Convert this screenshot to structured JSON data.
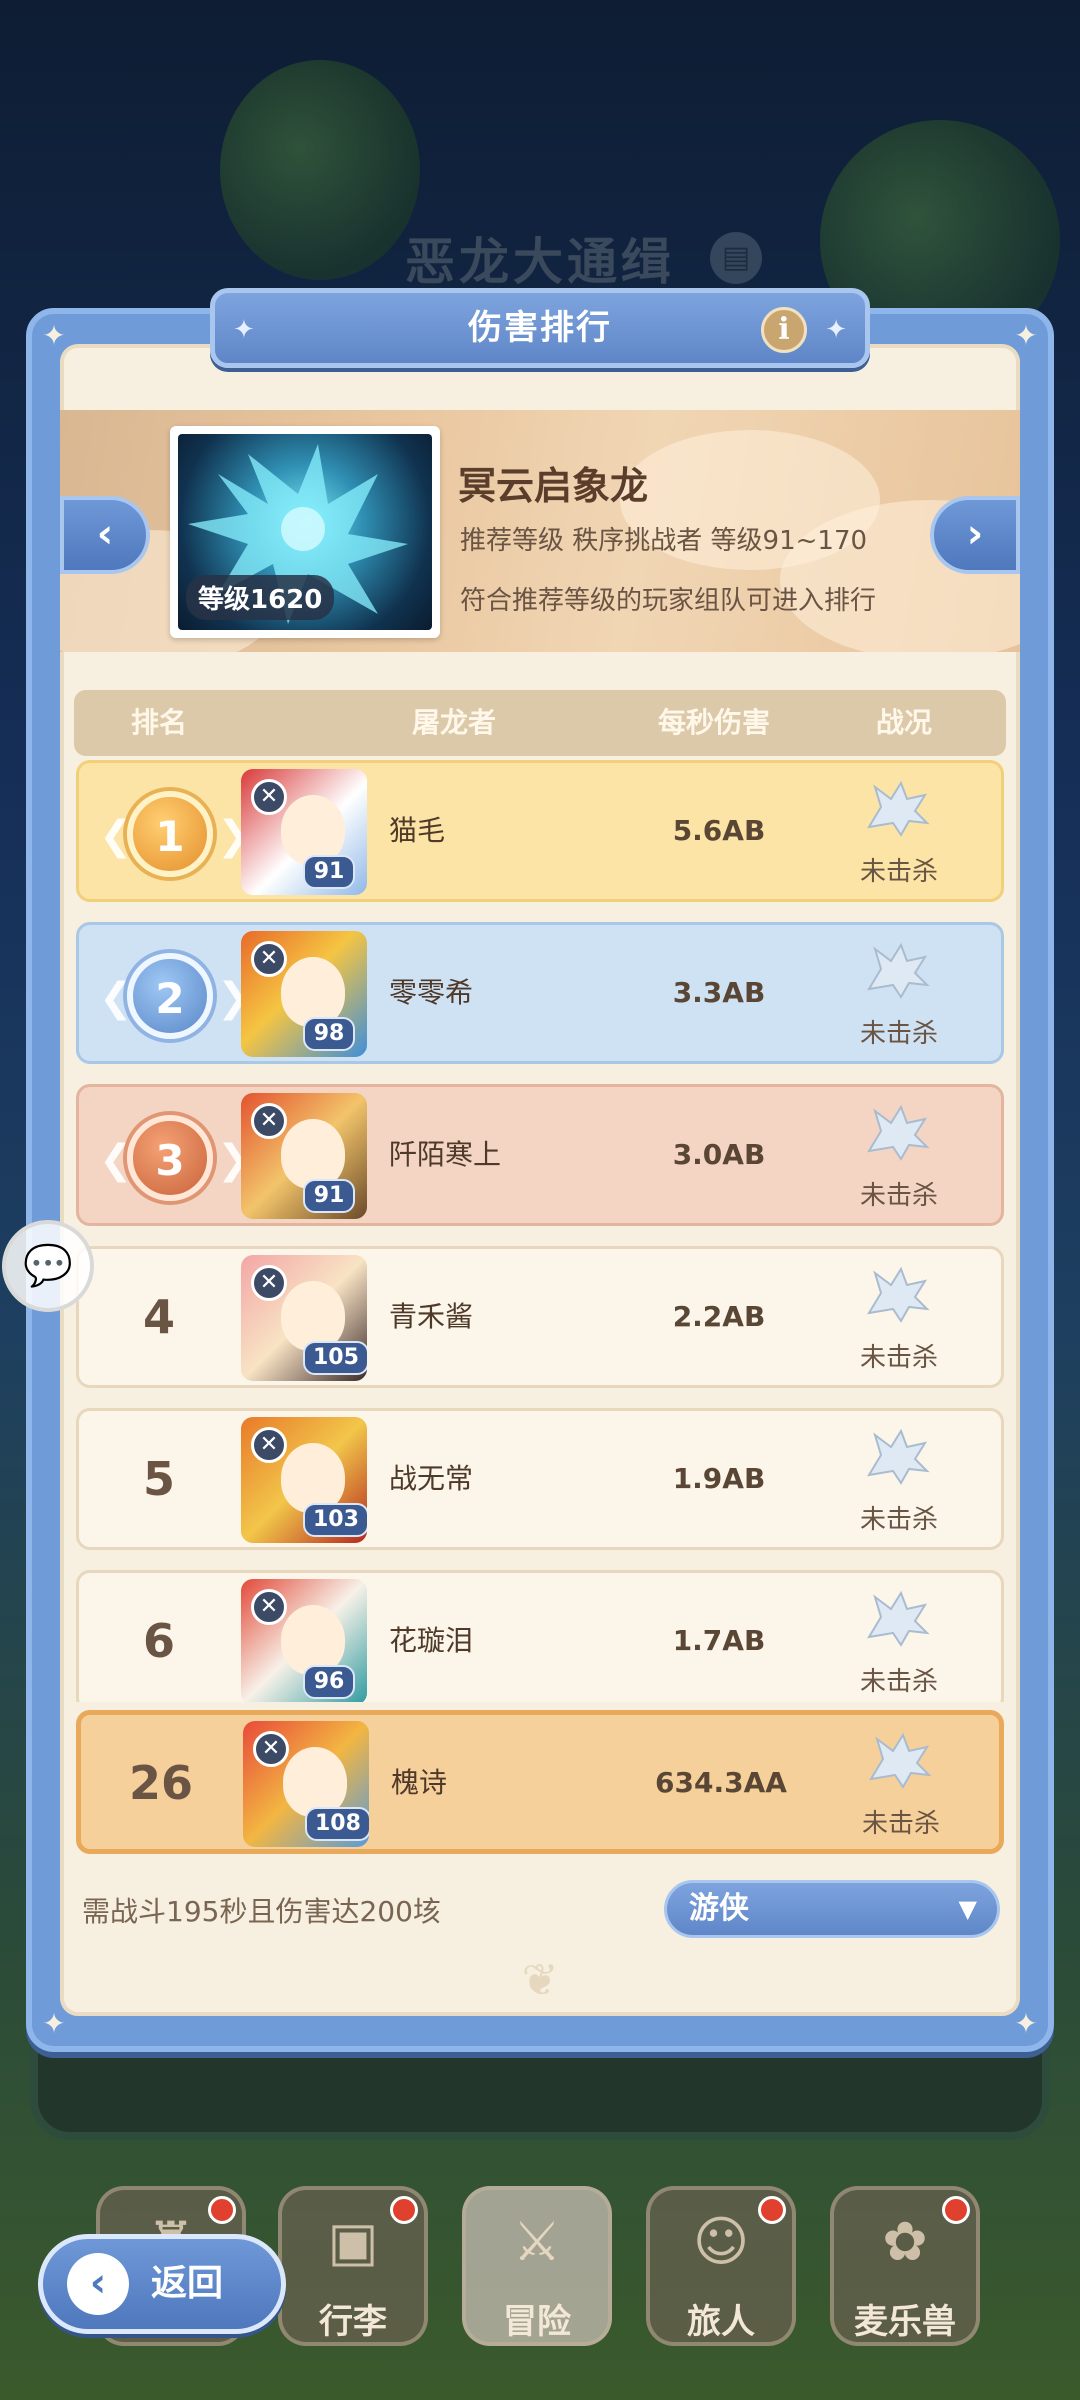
{
  "background": {
    "event_title": "恶龙大通缉",
    "event_icon_name": "scroll-badge-icon"
  },
  "dialog": {
    "title": "伤害排行",
    "info_icon": "info-icon"
  },
  "boss": {
    "name": "冥云启象龙",
    "level_label": "等级1620",
    "recommend_text": "推荐等级 秩序挑战者 等级91~170",
    "note_text": "符合推荐等级的玩家组队可进入排行",
    "prev_icon": "chevron-left-icon",
    "next_icon": "chevron-right-icon"
  },
  "table": {
    "headers": [
      "排名",
      "屠龙者",
      "每秒伤害",
      "战况"
    ],
    "rows": [
      {
        "rank": "1",
        "medal": "gold",
        "level": "91",
        "name": "猫毛",
        "dps": "5.6AB",
        "status": "未击杀"
      },
      {
        "rank": "2",
        "medal": "silver",
        "level": "98",
        "name": "零零希",
        "dps": "3.3AB",
        "status": "未击杀"
      },
      {
        "rank": "3",
        "medal": "bronze",
        "level": "91",
        "name": "阡陌寒上",
        "dps": "3.0AB",
        "status": "未击杀"
      },
      {
        "rank": "4",
        "medal": "",
        "level": "105",
        "name": "青禾酱",
        "dps": "2.2AB",
        "status": "未击杀"
      },
      {
        "rank": "5",
        "medal": "",
        "level": "103",
        "name": "战无常",
        "dps": "1.9AB",
        "status": "未击杀"
      },
      {
        "rank": "6",
        "medal": "",
        "level": "96",
        "name": "花璇泪",
        "dps": "1.7AB",
        "status": "未击杀"
      }
    ],
    "me": {
      "rank": "26",
      "level": "108",
      "name": "槐诗",
      "dps": "634.3AA",
      "status": "未击杀"
    }
  },
  "footer": {
    "requirement": "需战斗195秒且伤害达200垓",
    "class_select_value": "游侠"
  },
  "bottom_nav": {
    "back_label": "返回",
    "items": [
      {
        "label": "",
        "icon": "castle-icon",
        "dot": true
      },
      {
        "label": "行李",
        "icon": "chest-icon",
        "dot": true
      },
      {
        "label": "冒险",
        "icon": "crossed-swords-icon",
        "dot": false
      },
      {
        "label": "旅人",
        "icon": "traveler-icon",
        "dot": true
      },
      {
        "label": "麦乐兽",
        "icon": "pet-icon",
        "dot": true
      }
    ]
  },
  "colors": {
    "dialog_blue": "#6f9bd8",
    "panel_cream": "#f7efdf",
    "gold_row": "#fbe4a6",
    "silver_row": "#cfe2f4",
    "bronze_row": "#f4d5c4",
    "my_row": "#f6d09b",
    "notification_dot": "#e0412f"
  }
}
